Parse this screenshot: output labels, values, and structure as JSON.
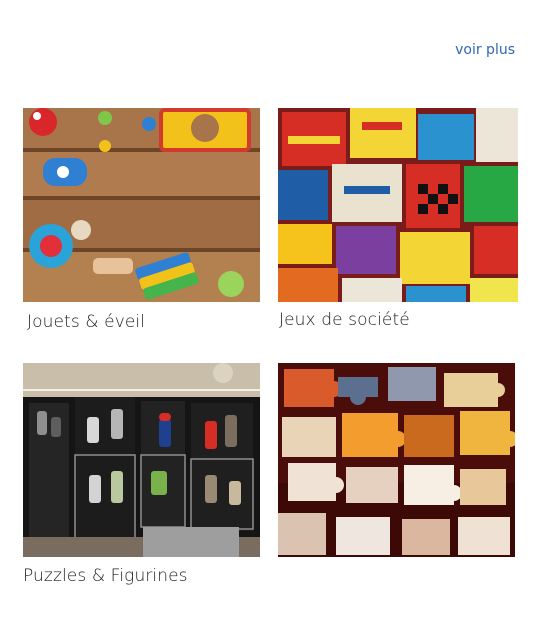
{
  "header": {
    "more_link": "voir plus"
  },
  "categories": [
    {
      "label": "Jouets & éveil",
      "image": "wooden-floor-toys"
    },
    {
      "label": "Jeux de société",
      "image": "board-game-boxes"
    },
    {
      "label": "Puzzles & Figurines",
      "image": "figurine-display-cabinet"
    },
    {
      "label": "",
      "image": "jigsaw-puzzle-pieces"
    }
  ]
}
